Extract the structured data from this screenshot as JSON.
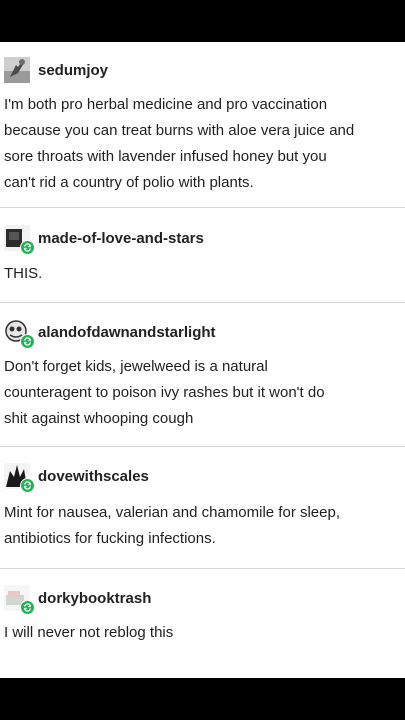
{
  "post": {
    "entries": [
      {
        "username": "sedumjoy",
        "avatar_icon": "flower-avatar-icon",
        "lines": [
          "I'm both pro herbal medicine and pro vaccination",
          "because you can treat burns with aloe vera juice and",
          "sore throats with lavender infused honey but you",
          "can't rid a country of polio with plants."
        ]
      },
      {
        "username": "made-of-love-and-stars",
        "avatar_icon": "dark-portrait-avatar-icon",
        "reblog_icon": "reblog-icon",
        "lines": [
          "THIS."
        ]
      },
      {
        "username": "alandofdawnandstarlight",
        "avatar_icon": "cartoon-face-avatar-icon",
        "reblog_icon": "reblog-icon",
        "lines": [
          "Don't forget kids, jewelweed is a natural",
          "counteragent to poison ivy rashes but it won't do",
          "shit against whooping cough"
        ]
      },
      {
        "username": "dovewithscales",
        "avatar_icon": "dark-figure-avatar-icon",
        "reblog_icon": "reblog-icon",
        "lines": [
          "Mint for nausea, valerian and chamomile for sleep,",
          "antibiotics for fucking infections."
        ]
      },
      {
        "username": "dorkybooktrash",
        "avatar_icon": "book-avatar-icon",
        "reblog_icon": "reblog-icon",
        "lines": [
          "I will never not reblog this"
        ]
      }
    ]
  },
  "colors": {
    "letterbox": "#000000",
    "card": "#ffffff",
    "text": "#1f1f1f",
    "username": "#222222",
    "reblog_badge": "#25b35a",
    "divider": "#d9d9d9"
  }
}
